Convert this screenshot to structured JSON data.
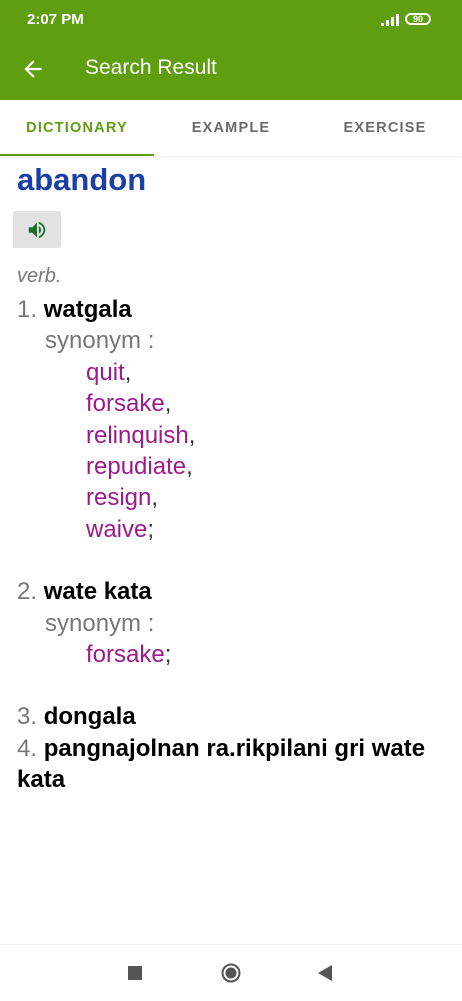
{
  "status": {
    "time": "2:07 PM",
    "battery": "90"
  },
  "appbar": {
    "title": "Search Result"
  },
  "tabs": [
    {
      "label": "DICTIONARY"
    },
    {
      "label": "EXAMPLE"
    },
    {
      "label": "EXERCISE"
    }
  ],
  "word": "abandon",
  "part_of_speech": "verb.",
  "synonym_label": "synonym :",
  "senses": [
    {
      "num": "1.",
      "meaning": "watgala",
      "synonyms": [
        "quit",
        "forsake",
        "relinquish",
        "repudiate",
        "resign",
        "waive"
      ]
    },
    {
      "num": "2.",
      "meaning": "wate kata",
      "synonyms": [
        "forsake"
      ]
    },
    {
      "num": "3.",
      "meaning": "dongala"
    },
    {
      "num": "4.",
      "meaning": "pangnajolnan ra.rikpilani gri wate kata"
    }
  ],
  "punct": {
    "comma": ",",
    "semicolon": ";"
  },
  "colors": {
    "primary": "#5f9e0f",
    "word": "#1b3ea8",
    "synonym": "#9c1a8c",
    "muted": "#777777"
  }
}
